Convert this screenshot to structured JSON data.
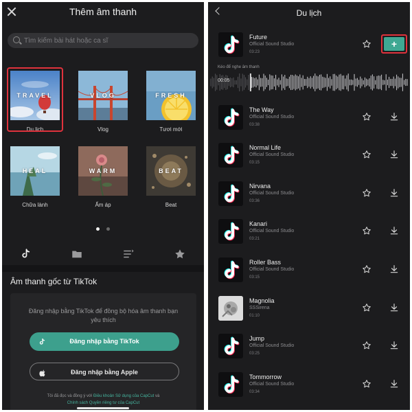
{
  "left": {
    "title": "Thêm âm thanh",
    "search_placeholder": "Tìm kiếm bài hát hoặc ca sĩ",
    "playlists": [
      {
        "word": "TRAVEL",
        "label": "Du lịch",
        "icon": "travel-cover"
      },
      {
        "word": "VLOG",
        "label": "Vlog",
        "icon": "bridge-cover"
      },
      {
        "word": "FRESH",
        "label": "Tươi mới",
        "icon": "lemon-cover"
      },
      {
        "word": "HEAL",
        "label": "Chữa lành",
        "icon": "sea-cover"
      },
      {
        "word": "WARM",
        "label": "Ấm áp",
        "icon": "flower-cover"
      },
      {
        "word": "BEAT",
        "label": "Beat",
        "icon": "splash-cover"
      }
    ],
    "selected_playlist": "Du lịch",
    "tabs": [
      "tiktok-icon",
      "folder-icon",
      "playlist-icon",
      "star-icon"
    ],
    "section_title": "Âm thanh gốc từ TikTok",
    "login_desc": "Đăng nhập bằng TikTok để đồng bộ hóa âm thanh bạn yêu thích",
    "btn_tiktok": "Đăng nhập bằng TikTok",
    "btn_apple": "Đăng nhập bằng Apple",
    "terms_pre": "Tôi đã đọc và đồng ý với ",
    "terms_link1": "Điều khoản Sử dụng của CapCut",
    "terms_mid": " và ",
    "terms_link2": "Chính sách Quyền riêng tư của CapCut",
    "accent": "#3da08d",
    "highlight": "#e0323c"
  },
  "right": {
    "title": "Du lịch",
    "drag_hint": "Kéo để nghe âm thanh",
    "playhead": "00:05",
    "add_label": "+",
    "songs": [
      {
        "name": "Future",
        "artist": "Official Sound Studio",
        "duration": "03:23"
      },
      {
        "name": "The Way",
        "artist": "Official Sound Studio",
        "duration": "03:38"
      },
      {
        "name": "Normal Life",
        "artist": "Official Sound Studio",
        "duration": "03:15"
      },
      {
        "name": "Nirvana",
        "artist": "Official Sound Studio",
        "duration": "03:36"
      },
      {
        "name": "Kanari",
        "artist": "Official Sound Studio",
        "duration": "03:21"
      },
      {
        "name": "Roller Bass",
        "artist": "Official Sound Studio",
        "duration": "03:15"
      },
      {
        "name": "Magnolia",
        "artist": "SSSirena",
        "duration": "01:10"
      },
      {
        "name": "Jump",
        "artist": "Official Sound Studio",
        "duration": "03:25"
      },
      {
        "name": "Tommorrow",
        "artist": "Official Sound Studio",
        "duration": "03:34"
      }
    ]
  }
}
